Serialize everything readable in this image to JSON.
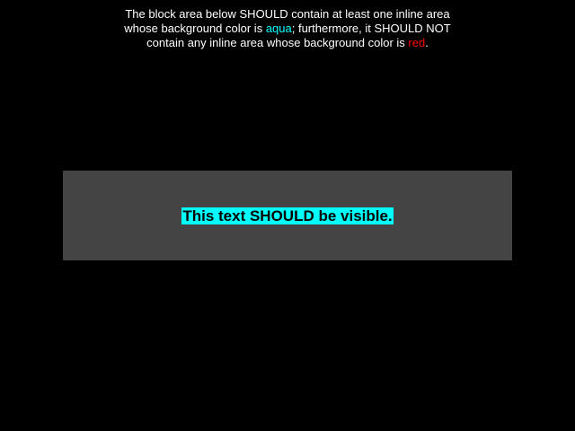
{
  "instructions": {
    "line1": "The block area below SHOULD contain at least one inline area",
    "line2_before": "whose background color is ",
    "aqua_word": "aqua",
    "line2_after": "; furthermore, it SHOULD NOT",
    "line3_before": "contain any inline area whose background color is ",
    "red_word": "red",
    "line3_after": "."
  },
  "test": {
    "visible_text": "This text SHOULD be visible."
  },
  "colors": {
    "background": "#000000",
    "block_background": "#444444",
    "aqua": "#00ffff",
    "red": "#ff0000",
    "text": "#ffffff"
  }
}
